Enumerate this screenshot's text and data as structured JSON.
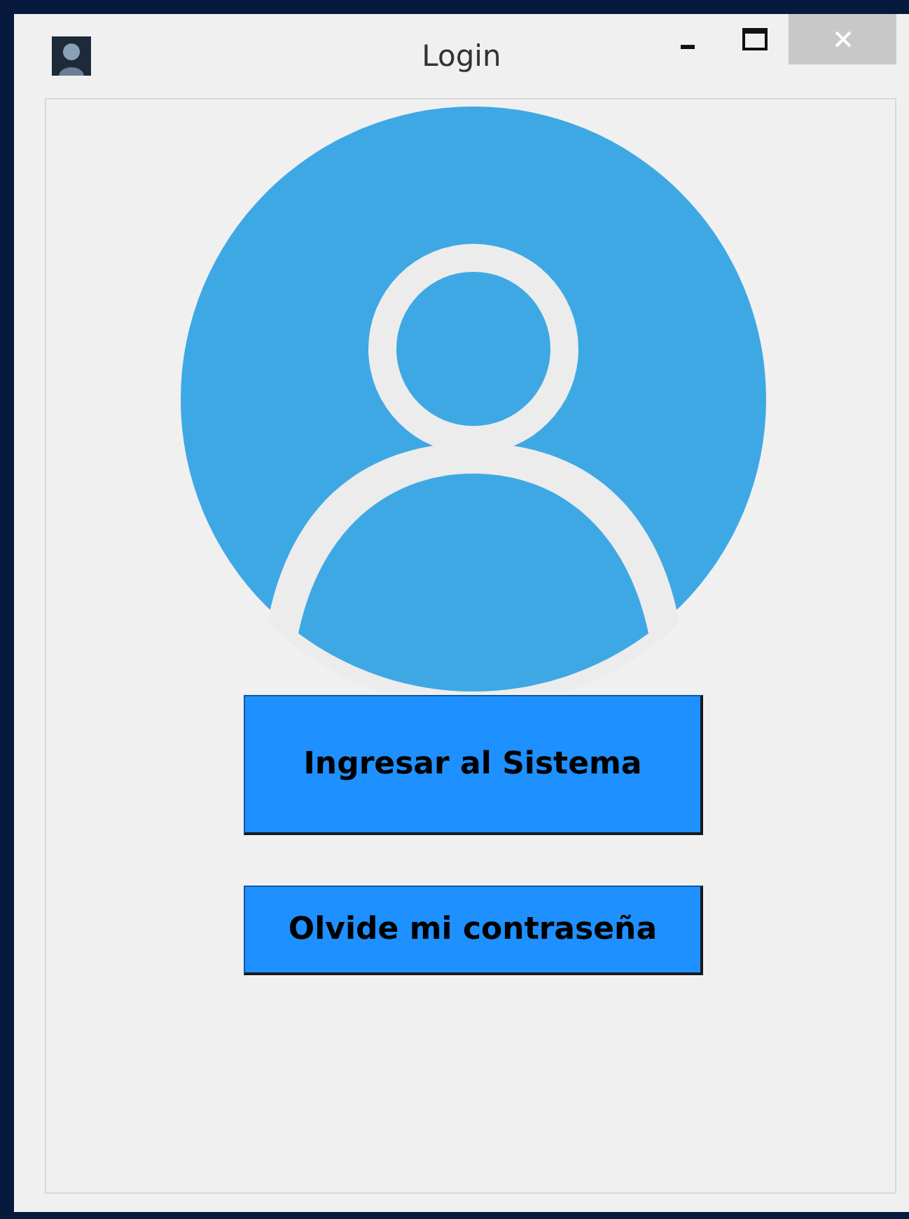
{
  "window": {
    "title": "Login"
  },
  "buttons": [
    {
      "label": "Ingresar al Sistema",
      "kind": "tall"
    },
    {
      "label": "Olvide mi contraseña",
      "kind": "short"
    }
  ]
}
